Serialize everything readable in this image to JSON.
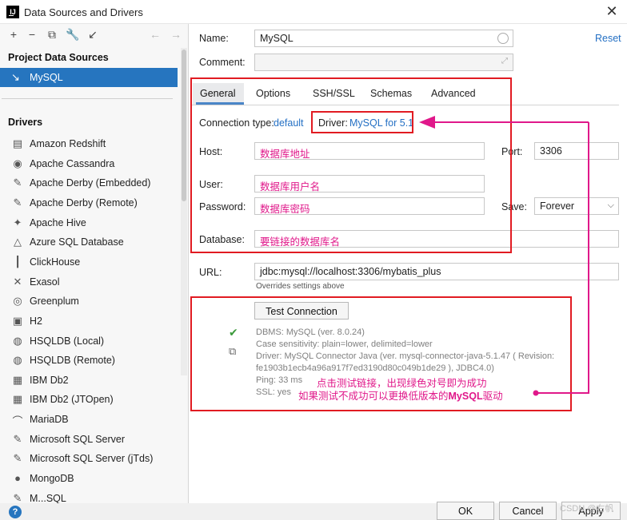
{
  "window": {
    "title": "Data Sources and Drivers",
    "close_glyph": "✕"
  },
  "left_toolbar": {
    "icons": [
      "add-icon",
      "remove-icon",
      "duplicate-icon",
      "wrench-icon",
      "import-icon",
      "back-arrow-icon",
      "forward-arrow-icon"
    ]
  },
  "project_section": {
    "title": "Project Data Sources",
    "selected_item": "MySQL"
  },
  "drivers_section": {
    "title": "Drivers",
    "items": [
      {
        "label": "Amazon Redshift",
        "icon": "▤"
      },
      {
        "label": "Apache Cassandra",
        "icon": "◉"
      },
      {
        "label": "Apache Derby (Embedded)",
        "icon": "✎"
      },
      {
        "label": "Apache Derby (Remote)",
        "icon": "✎"
      },
      {
        "label": "Apache Hive",
        "icon": "✦"
      },
      {
        "label": "Azure SQL Database",
        "icon": "△"
      },
      {
        "label": "ClickHouse",
        "icon": "┃"
      },
      {
        "label": "Exasol",
        "icon": "✕"
      },
      {
        "label": "Greenplum",
        "icon": "◎"
      },
      {
        "label": "H2",
        "icon": "▣"
      },
      {
        "label": "HSQLDB (Local)",
        "icon": "◍"
      },
      {
        "label": "HSQLDB (Remote)",
        "icon": "◍"
      },
      {
        "label": "IBM Db2",
        "icon": "▦"
      },
      {
        "label": "IBM Db2 (JTOpen)",
        "icon": "▦"
      },
      {
        "label": "MariaDB",
        "icon": "⌒"
      },
      {
        "label": "Microsoft SQL Server",
        "icon": "✎"
      },
      {
        "label": "Microsoft SQL Server (jTds)",
        "icon": "✎"
      },
      {
        "label": "MongoDB",
        "icon": "●"
      },
      {
        "label": "M...SQL",
        "icon": "✎"
      }
    ]
  },
  "form": {
    "name_label": "Name:",
    "name_value": "MySQL",
    "reset_link": "Reset",
    "comment_label": "Comment:",
    "comment_value": "",
    "tabs": [
      "General",
      "Options",
      "SSH/SSL",
      "Schemas",
      "Advanced"
    ],
    "connection_type_label": "Connection type:",
    "connection_type_value": "default",
    "driver_label": "Driver:",
    "driver_value": "MySQL for 5.1",
    "host_label": "Host:",
    "host_value": "数据库地址",
    "port_label": "Port:",
    "port_value": "3306",
    "user_label": "User:",
    "user_value": "数据库用户名",
    "password_label": "Password:",
    "password_value": "数据库密码",
    "save_label": "Save:",
    "save_value": "Forever",
    "database_label": "Database:",
    "database_value": "要链接的数据库名",
    "url_label": "URL:",
    "url_value": "jdbc:mysql://localhost:3306/mybatis_plus",
    "url_hint": "Overrides settings above"
  },
  "test": {
    "button": "Test Connection",
    "lines": [
      "DBMS: MySQL (ver. 8.0.24)",
      "Case sensitivity: plain=lower, delimited=lower",
      "Driver: MySQL Connector Java (ver. mysql-connector-java-5.1.47 ( Revision:",
      "fe1903b1ecb4a96a917f7ed3190d80c049b1de29 ), JDBC4.0)",
      "Ping: 33 ms",
      "SSL: yes"
    ],
    "annotation_1": "点击测试链接，出现绿色对号即为成功",
    "annotation_2_pre": "如果测试不成功可以更换低版本的",
    "annotation_2_bold": "MySQL",
    "annotation_2_post": "驱动"
  },
  "footer": {
    "ok": "OK",
    "cancel": "Cancel",
    "apply": "Apply",
    "help": "?",
    "watermark": "CSDN @右帆"
  },
  "colors": {
    "accent": "#2675bf",
    "annotation_pink": "#e0188a",
    "annotation_red": "#e11b22",
    "success_green": "#3c9a3c"
  }
}
